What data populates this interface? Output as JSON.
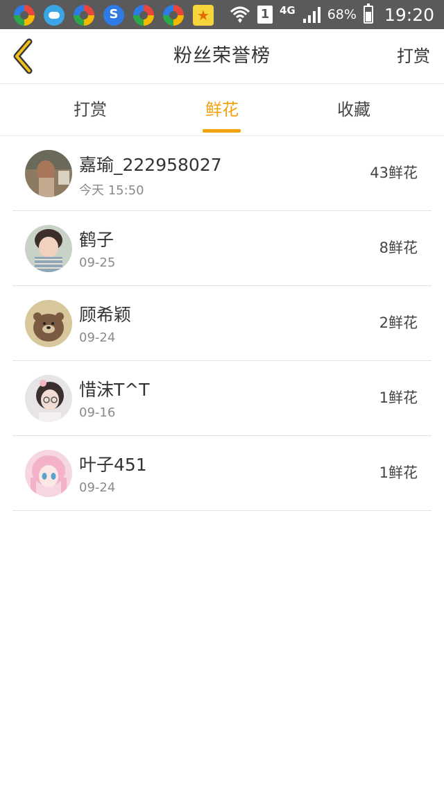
{
  "status_bar": {
    "network": "4G",
    "sim": "1",
    "battery": "68%",
    "time": "19:20",
    "icons": [
      "multicolor-app-icon",
      "cloud-app-icon",
      "multicolor-app-icon",
      "sogou-icon",
      "multicolor-app-icon",
      "multicolor-app-icon",
      "star-app-icon"
    ]
  },
  "header": {
    "title": "粉丝荣誉榜",
    "action": "打赏"
  },
  "tabs": [
    {
      "label": "打赏",
      "active": false
    },
    {
      "label": "鲜花",
      "active": true
    },
    {
      "label": "收藏",
      "active": false
    }
  ],
  "fans": [
    {
      "name": "嘉瑜_222958027",
      "date": "今天 15:50",
      "count": "43鲜花"
    },
    {
      "name": "鹤子",
      "date": "09-25",
      "count": "8鲜花"
    },
    {
      "name": "顾希颖",
      "date": "09-24",
      "count": "2鲜花"
    },
    {
      "name": "惜沫T^T",
      "date": "09-16",
      "count": "1鲜花"
    },
    {
      "name": "叶子451",
      "date": "09-24",
      "count": "1鲜花"
    }
  ],
  "colors": {
    "accent": "#f2a10f",
    "status_bar": "#5a5a5a",
    "text": "#333333",
    "muted": "#8a8a8a",
    "divider": "#e4e4e4"
  }
}
